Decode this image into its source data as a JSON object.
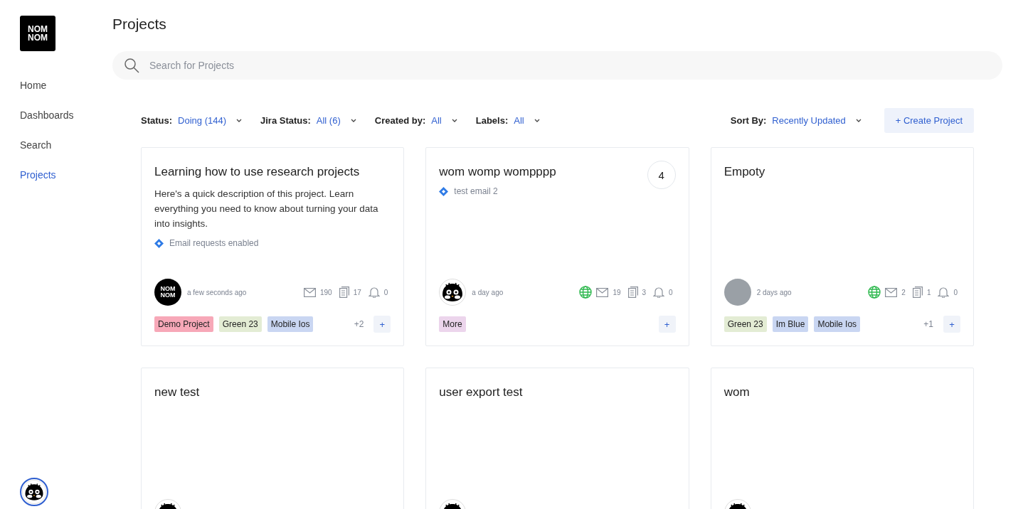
{
  "sidebar": {
    "logo": "NOM NOM",
    "items": [
      {
        "label": "Home",
        "selected": false
      },
      {
        "label": "Dashboards",
        "selected": false
      },
      {
        "label": "Search",
        "selected": false
      },
      {
        "label": "Projects",
        "selected": true
      }
    ]
  },
  "page_title": "Projects",
  "search": {
    "placeholder": "Search for Projects"
  },
  "filters": [
    {
      "label": "Status:",
      "value": "Doing (144)"
    },
    {
      "label": "Jira Status:",
      "value": "All (6)"
    },
    {
      "label": "Created by:",
      "value": "All"
    },
    {
      "label": "Labels:",
      "value": "All"
    }
  ],
  "sort": {
    "label": "Sort By:",
    "value": "Recently Updated"
  },
  "create_button": "+ Create Project",
  "projects": [
    {
      "title": "Learning how to use research projects",
      "description": "Here's a quick description of this project. Learn everything you need to know about turning your data into insights.",
      "email_note": "Email requests enabled",
      "avatar": {
        "kind": "logo",
        "text": "NOM NOM"
      },
      "updated": "a few seconds ago",
      "public": false,
      "emails": "190",
      "documents": "17",
      "notifications": "0",
      "add_tag": "+",
      "tags": [
        {
          "label": "Demo Project",
          "color": "#f7a8b8"
        },
        {
          "label": "Green 23",
          "color": "#e3ecd4"
        },
        {
          "label": "Mobile Ios",
          "color": "#c9d6f2"
        }
      ],
      "more_tags": "+2"
    },
    {
      "title": "wom womp wompppp",
      "count": "4",
      "email_note": "test email 2",
      "avatar": {
        "kind": "cat"
      },
      "updated": "a day ago",
      "public": true,
      "emails": "19",
      "documents": "3",
      "notifications": "0",
      "add_tag": "+",
      "tags": [
        {
          "label": "More",
          "color": "#ecd5ec"
        }
      ]
    },
    {
      "title": "Empoty",
      "avatar": {
        "kind": "photo"
      },
      "updated": "2 days ago",
      "public": true,
      "emails": "2",
      "documents": "1",
      "notifications": "0",
      "add_tag": "+",
      "tags": [
        {
          "label": "Green 23",
          "color": "#e3ecd4"
        },
        {
          "label": "Im Blue",
          "color": "#c9d6f2"
        },
        {
          "label": "Mobile Ios",
          "color": "#c9d6f2"
        }
      ],
      "more_tags": "+1"
    },
    {
      "title": "new test",
      "avatar": {
        "kind": "cat"
      }
    },
    {
      "title": "user export test",
      "avatar": {
        "kind": "cat"
      }
    },
    {
      "title": "wom",
      "avatar": {
        "kind": "cat"
      }
    }
  ]
}
